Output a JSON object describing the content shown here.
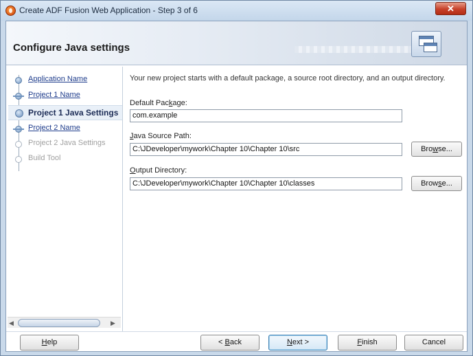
{
  "window": {
    "title": "Create ADF Fusion Web Application - Step 3 of 6",
    "close_label": "✕"
  },
  "header": {
    "title": "Configure Java settings",
    "icon": "windows-icon"
  },
  "nav": {
    "items": [
      {
        "label": "Application Name",
        "state": "link"
      },
      {
        "label": "Project 1 Name",
        "state": "link"
      },
      {
        "label": "Project 1 Java Settings",
        "state": "current"
      },
      {
        "label": "Project 2 Name",
        "state": "link"
      },
      {
        "label": "Project 2 Java Settings",
        "state": "disabled"
      },
      {
        "label": "Build Tool",
        "state": "disabled"
      }
    ]
  },
  "content": {
    "intro": "Your new project starts with a default package, a source root directory, and an output directory.",
    "default_package": {
      "label_pre": "Default Pac",
      "label_mnemonic": "k",
      "label_post": "age:",
      "value": "com.example"
    },
    "java_source_path": {
      "label_mnemonic": "J",
      "label_post": "ava Source Path:",
      "value": "C:\\JDeveloper\\mywork\\Chapter 10\\Chapter 10\\src",
      "browse_pre": "Bro",
      "browse_mnemonic": "w",
      "browse_post": "se..."
    },
    "output_directory": {
      "label_mnemonic": "O",
      "label_post": "utput Directory:",
      "value": "C:\\JDeveloper\\mywork\\Chapter 10\\Chapter 10\\classes",
      "browse_pre": "Brow",
      "browse_mnemonic": "s",
      "browse_post": "e..."
    }
  },
  "footer": {
    "help": {
      "mnemonic": "H",
      "rest": "elp"
    },
    "back": {
      "pre": "< ",
      "mnemonic": "B",
      "rest": "ack"
    },
    "next": {
      "mnemonic": "N",
      "rest": "ext >"
    },
    "finish": {
      "mnemonic": "F",
      "rest": "inish"
    },
    "cancel": "Cancel"
  },
  "colors": {
    "link": "#1f3d8c",
    "current_step": "#1b2b55",
    "close_button": "#c7412a"
  }
}
